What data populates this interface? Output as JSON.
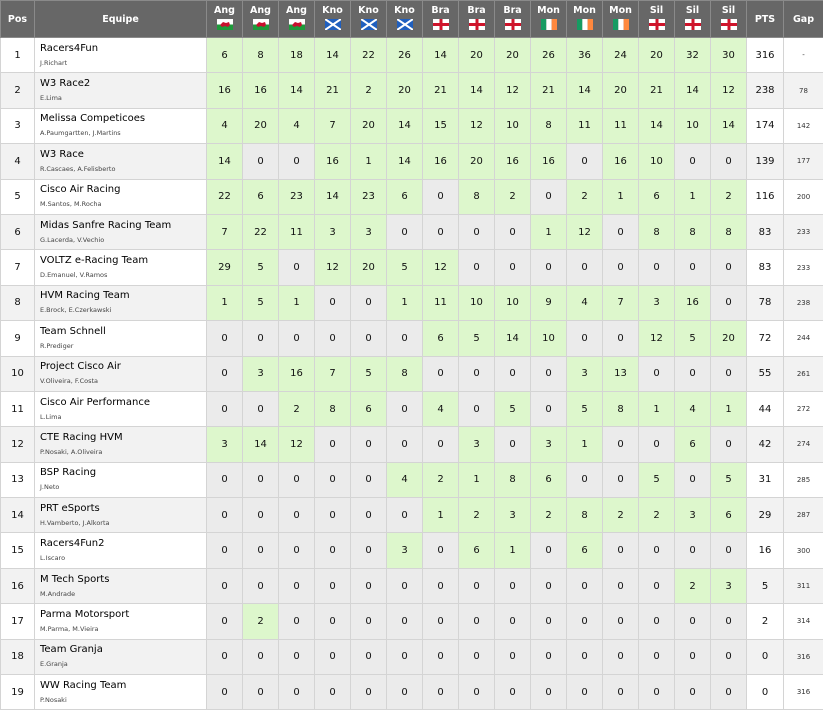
{
  "header": {
    "pos": "Pos",
    "team": "Equipe",
    "pts": "PTS",
    "gap": "Gap",
    "races": [
      {
        "label": "Ang",
        "flag": "wales"
      },
      {
        "label": "Ang",
        "flag": "wales"
      },
      {
        "label": "Ang",
        "flag": "wales"
      },
      {
        "label": "Kno",
        "flag": "scotland"
      },
      {
        "label": "Kno",
        "flag": "scotland"
      },
      {
        "label": "Kno",
        "flag": "scotland"
      },
      {
        "label": "Bra",
        "flag": "england"
      },
      {
        "label": "Bra",
        "flag": "england"
      },
      {
        "label": "Bra",
        "flag": "england"
      },
      {
        "label": "Mon",
        "flag": "ireland"
      },
      {
        "label": "Mon",
        "flag": "ireland"
      },
      {
        "label": "Mon",
        "flag": "ireland"
      },
      {
        "label": "Sil",
        "flag": "england"
      },
      {
        "label": "Sil",
        "flag": "england"
      },
      {
        "label": "Sil",
        "flag": "england"
      }
    ]
  },
  "colors": {
    "header_bg": "#676767",
    "points_cell": "#ddf7cc",
    "zero_cell": "#ebebeb"
  },
  "rows": [
    {
      "pos": "1",
      "team": "Racers4Fun",
      "drivers": "J.Richart",
      "scores": [
        6,
        8,
        18,
        14,
        22,
        26,
        14,
        20,
        20,
        26,
        36,
        24,
        20,
        32,
        30
      ],
      "pts": "316",
      "gap": "-"
    },
    {
      "pos": "2",
      "team": "W3 Race2",
      "drivers": "E.Lima",
      "scores": [
        16,
        16,
        14,
        21,
        2,
        20,
        21,
        14,
        12,
        21,
        14,
        20,
        21,
        14,
        12
      ],
      "pts": "238",
      "gap": "78"
    },
    {
      "pos": "3",
      "team": "Melissa Competicoes",
      "drivers": "A.Paumgartten, J.Martins",
      "scores": [
        4,
        20,
        4,
        7,
        20,
        14,
        15,
        12,
        10,
        8,
        11,
        11,
        14,
        10,
        14
      ],
      "pts": "174",
      "gap": "142"
    },
    {
      "pos": "4",
      "team": "W3 Race",
      "drivers": "R.Cascaes, A.Felisberto",
      "scores": [
        14,
        0,
        0,
        16,
        1,
        14,
        16,
        20,
        16,
        16,
        0,
        16,
        10,
        0,
        0
      ],
      "pts": "139",
      "gap": "177"
    },
    {
      "pos": "5",
      "team": "Cisco Air Racing",
      "drivers": "M.Santos, M.Rocha",
      "scores": [
        22,
        6,
        23,
        14,
        23,
        6,
        0,
        8,
        2,
        0,
        2,
        1,
        6,
        1,
        2
      ],
      "pts": "116",
      "gap": "200"
    },
    {
      "pos": "6",
      "team": "Midas Sanfre Racing Team",
      "drivers": "G.Lacerda, V.Vechio",
      "scores": [
        7,
        22,
        11,
        3,
        3,
        0,
        0,
        0,
        0,
        1,
        12,
        0,
        8,
        8,
        8
      ],
      "pts": "83",
      "gap": "233"
    },
    {
      "pos": "7",
      "team": "VOLTZ e-Racing Team",
      "drivers": "D.Emanuel, V.Ramos",
      "scores": [
        29,
        5,
        0,
        12,
        20,
        5,
        12,
        0,
        0,
        0,
        0,
        0,
        0,
        0,
        0
      ],
      "pts": "83",
      "gap": "233"
    },
    {
      "pos": "8",
      "team": "HVM Racing Team",
      "drivers": "E.Brock, E.Czerkawski",
      "scores": [
        1,
        5,
        1,
        0,
        0,
        1,
        11,
        10,
        10,
        9,
        4,
        7,
        3,
        16,
        0
      ],
      "pts": "78",
      "gap": "238"
    },
    {
      "pos": "9",
      "team": "Team Schnell",
      "drivers": "R.Prediger",
      "scores": [
        0,
        0,
        0,
        0,
        0,
        0,
        6,
        5,
        14,
        10,
        0,
        0,
        12,
        5,
        20
      ],
      "pts": "72",
      "gap": "244"
    },
    {
      "pos": "10",
      "team": "Project Cisco Air",
      "drivers": "V.Oliveira, F.Costa",
      "scores": [
        0,
        3,
        16,
        7,
        5,
        8,
        0,
        0,
        0,
        0,
        3,
        13,
        0,
        0,
        0
      ],
      "pts": "55",
      "gap": "261"
    },
    {
      "pos": "11",
      "team": "Cisco Air Performance",
      "drivers": "L.Lima",
      "scores": [
        0,
        0,
        2,
        8,
        6,
        0,
        4,
        0,
        5,
        0,
        5,
        8,
        1,
        4,
        1
      ],
      "pts": "44",
      "gap": "272"
    },
    {
      "pos": "12",
      "team": "CTE Racing HVM",
      "drivers": "P.Nosaki, A.Oliveira",
      "scores": [
        3,
        14,
        12,
        0,
        0,
        0,
        0,
        3,
        0,
        3,
        1,
        0,
        0,
        6,
        0
      ],
      "pts": "42",
      "gap": "274"
    },
    {
      "pos": "13",
      "team": "BSP Racing",
      "drivers": "J.Neto",
      "scores": [
        0,
        0,
        0,
        0,
        0,
        4,
        2,
        1,
        8,
        6,
        0,
        0,
        5,
        0,
        5
      ],
      "pts": "31",
      "gap": "285"
    },
    {
      "pos": "14",
      "team": "PRT eSports",
      "drivers": "H.Vamberto, J.Alkorta",
      "scores": [
        0,
        0,
        0,
        0,
        0,
        0,
        1,
        2,
        3,
        2,
        8,
        2,
        2,
        3,
        6
      ],
      "pts": "29",
      "gap": "287"
    },
    {
      "pos": "15",
      "team": "Racers4Fun2",
      "drivers": "L.Iscaro",
      "scores": [
        0,
        0,
        0,
        0,
        0,
        3,
        0,
        6,
        1,
        0,
        6,
        0,
        0,
        0,
        0
      ],
      "pts": "16",
      "gap": "300"
    },
    {
      "pos": "16",
      "team": "M Tech Sports",
      "drivers": "M.Andrade",
      "scores": [
        0,
        0,
        0,
        0,
        0,
        0,
        0,
        0,
        0,
        0,
        0,
        0,
        0,
        2,
        3
      ],
      "pts": "5",
      "gap": "311"
    },
    {
      "pos": "17",
      "team": "Parma Motorsport",
      "drivers": "M.Parma, M.Vieira",
      "scores": [
        0,
        2,
        0,
        0,
        0,
        0,
        0,
        0,
        0,
        0,
        0,
        0,
        0,
        0,
        0
      ],
      "pts": "2",
      "gap": "314"
    },
    {
      "pos": "18",
      "team": "Team Granja",
      "drivers": "E.Granja",
      "scores": [
        0,
        0,
        0,
        0,
        0,
        0,
        0,
        0,
        0,
        0,
        0,
        0,
        0,
        0,
        0
      ],
      "pts": "0",
      "gap": "316"
    },
    {
      "pos": "19",
      "team": "WW Racing Team",
      "drivers": "P.Nosaki",
      "scores": [
        0,
        0,
        0,
        0,
        0,
        0,
        0,
        0,
        0,
        0,
        0,
        0,
        0,
        0,
        0
      ],
      "pts": "0",
      "gap": "316"
    }
  ]
}
